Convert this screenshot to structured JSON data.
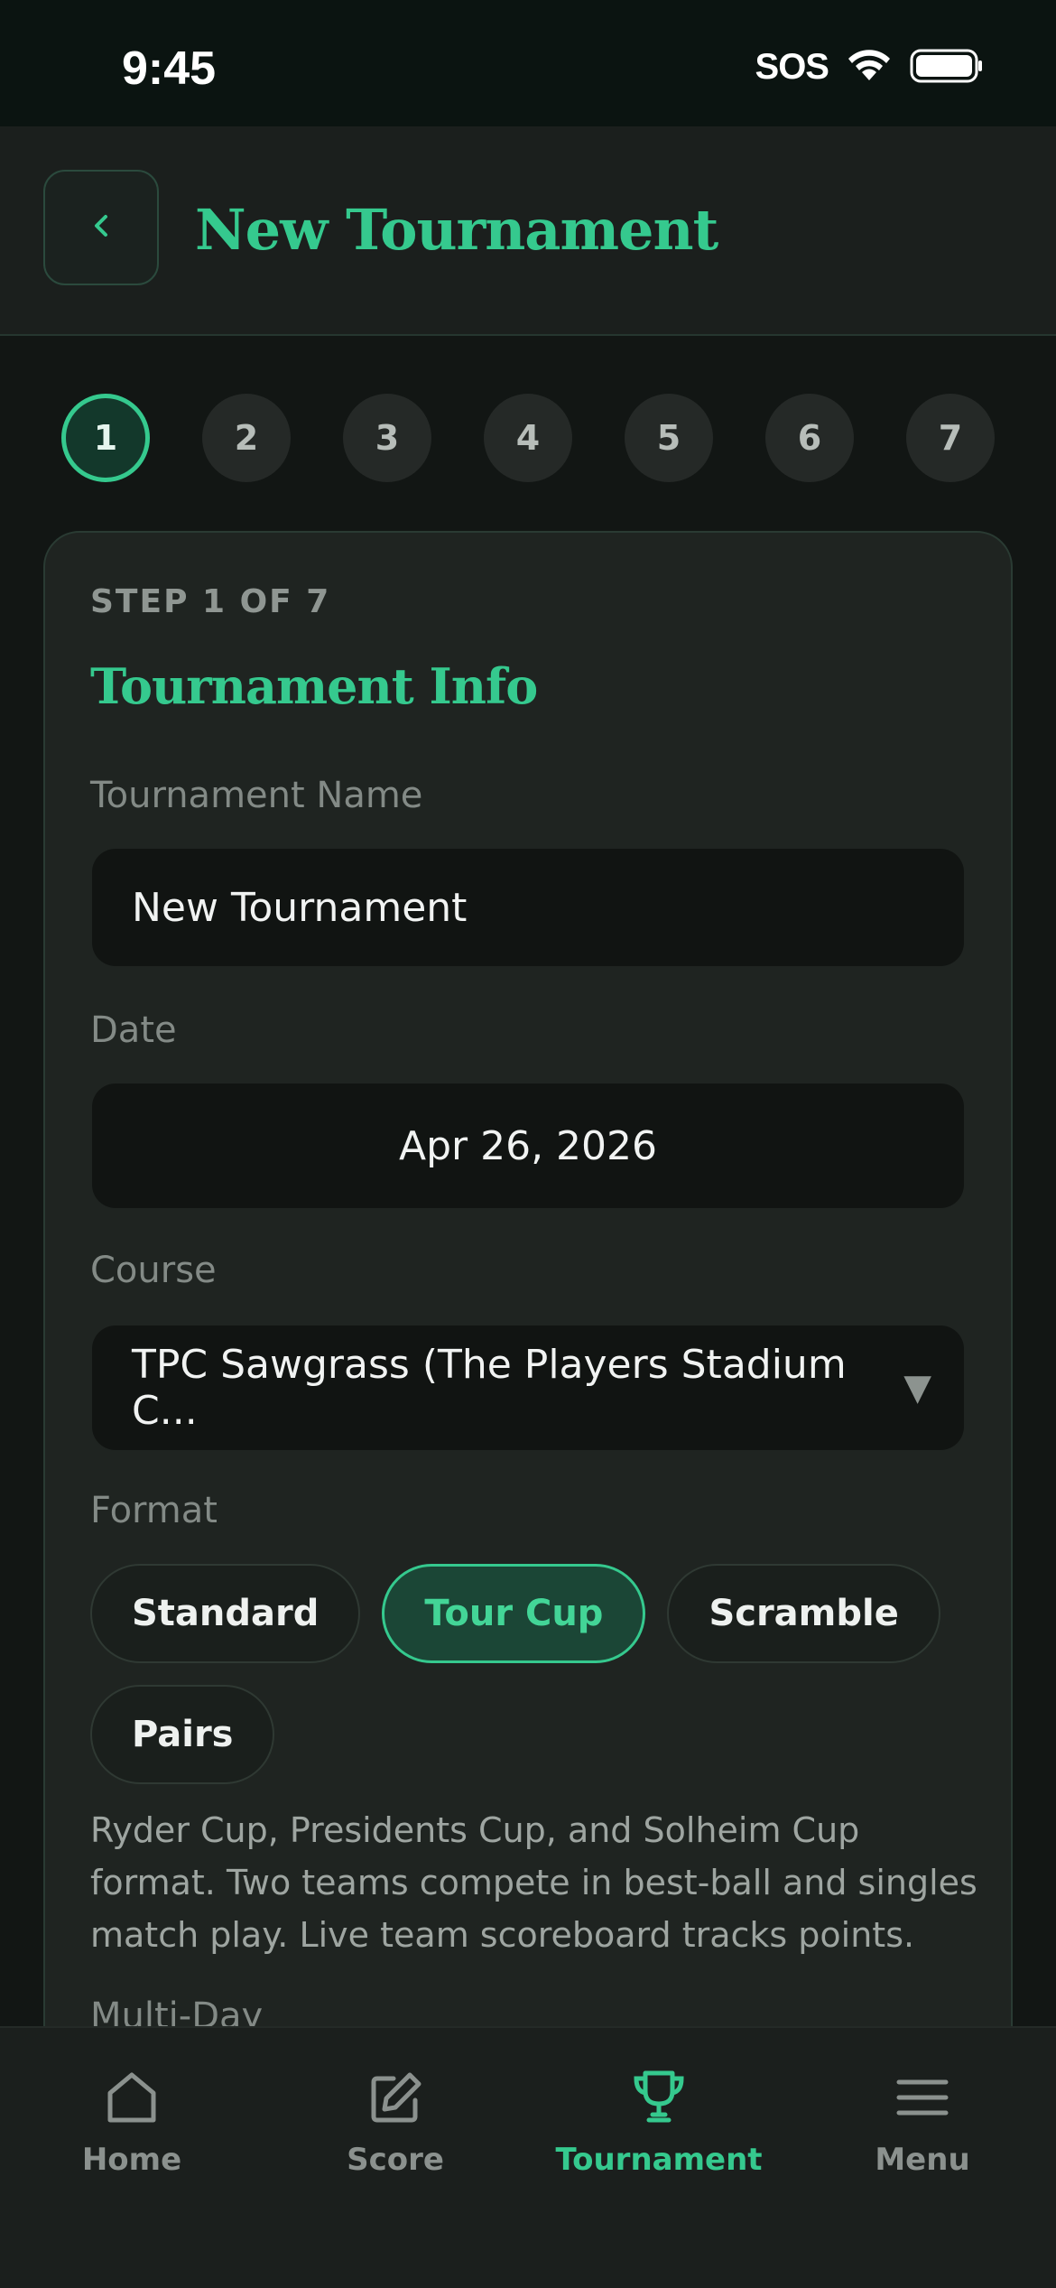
{
  "status": {
    "time": "9:45",
    "sos": "SOS"
  },
  "header": {
    "title": "New Tournament"
  },
  "steps": [
    "1",
    "2",
    "3",
    "4",
    "5",
    "6",
    "7"
  ],
  "card": {
    "step_label": "STEP 1 OF 7",
    "section_title": "Tournament Info",
    "name_label": "Tournament Name",
    "name_value": "New Tournament",
    "date_label": "Date",
    "date_value": "Apr 26, 2026",
    "course_label": "Course",
    "course_value": "TPC Sawgrass (The Players Stadium C...",
    "format_label": "Format",
    "formats": [
      "Standard",
      "Tour Cup",
      "Scramble",
      "Pairs"
    ],
    "selected_format": "Tour Cup",
    "format_description": "Ryder Cup, Presidents Cup, and Solheim Cup format. Two teams compete in best-ball and singles match play. Live team scoreboard tracks points.",
    "multiday_label": "Multi-Day"
  },
  "tabbar": {
    "items": [
      {
        "label": "Home",
        "icon": "home-icon"
      },
      {
        "label": "Score",
        "icon": "edit-icon"
      },
      {
        "label": "Tournament",
        "icon": "trophy-icon"
      },
      {
        "label": "Menu",
        "icon": "menu-icon"
      }
    ],
    "active": "Tournament"
  },
  "colors": {
    "accent": "#35c98e",
    "background": "#121614",
    "card": "#1f2421"
  }
}
